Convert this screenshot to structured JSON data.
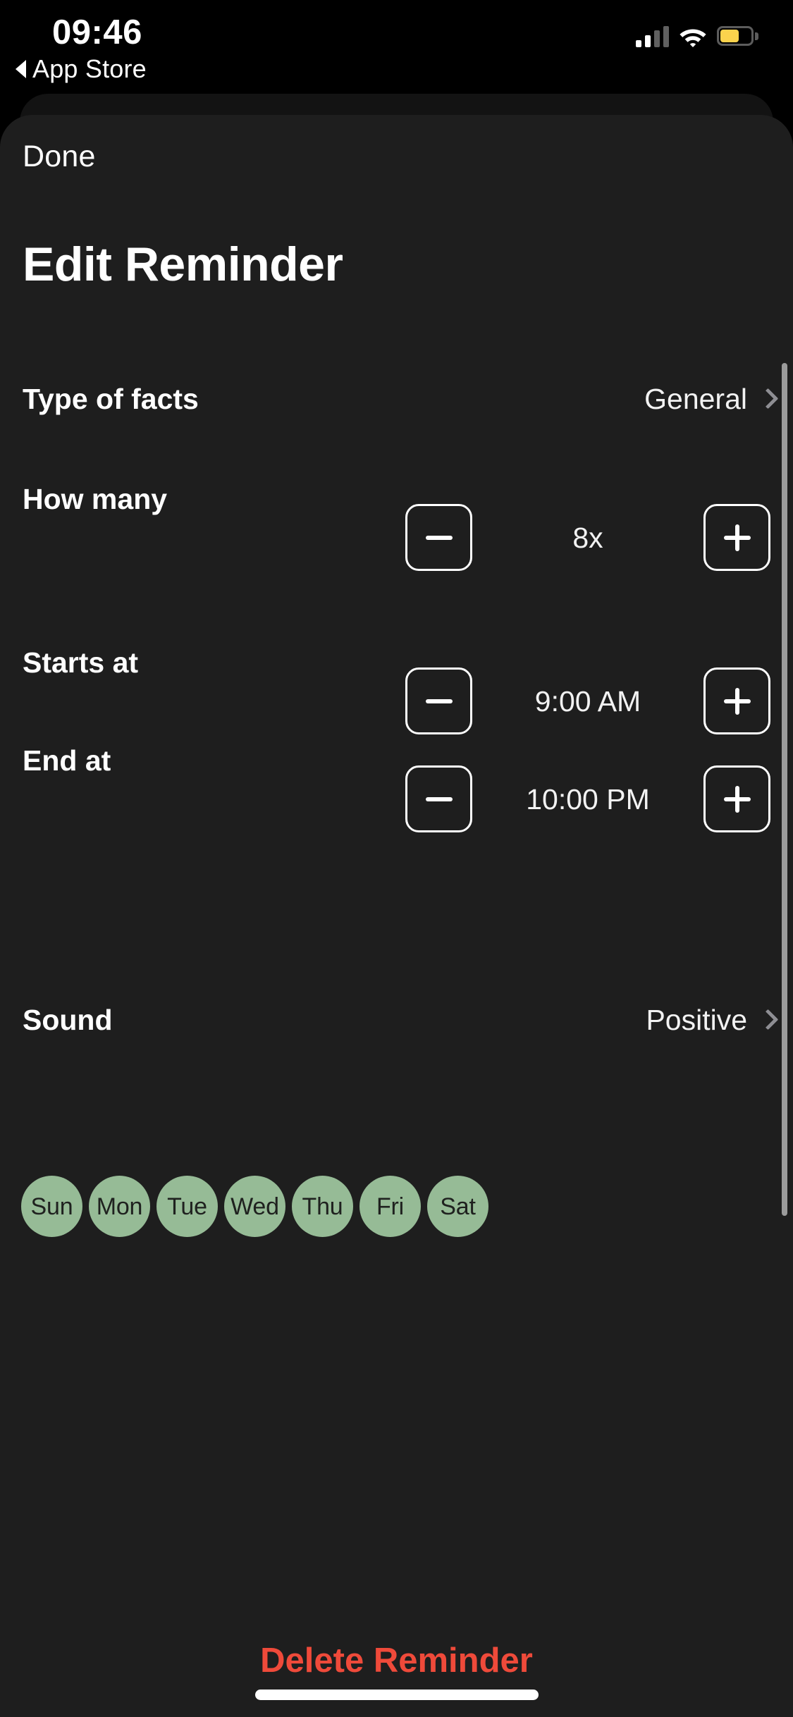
{
  "status_bar": {
    "time": "09:46",
    "back_label": "App Store",
    "back_icon": "back-triangle-icon",
    "signal_icon": "cellular-signal-icon",
    "signal_bars_active": 2,
    "signal_bars_total": 4,
    "wifi_icon": "wifi-icon",
    "battery_icon": "battery-icon",
    "battery_color": "#fbd34d",
    "battery_level_percent": 62
  },
  "sheet": {
    "done_label": "Done",
    "title": "Edit Reminder"
  },
  "rows": {
    "type_of_facts": {
      "label": "Type of facts",
      "value": "General",
      "chevron_icon": "chevron-right-icon"
    },
    "how_many": {
      "label": "How many",
      "value": "8x",
      "minus_icon": "minus-icon",
      "plus_icon": "plus-icon"
    },
    "starts_at": {
      "label": "Starts at",
      "value": "9:00 AM",
      "minus_icon": "minus-icon",
      "plus_icon": "plus-icon"
    },
    "end_at": {
      "label": "End at",
      "value": "10:00 PM",
      "minus_icon": "minus-icon",
      "plus_icon": "plus-icon"
    },
    "sound": {
      "label": "Sound",
      "value": "Positive",
      "chevron_icon": "chevron-right-icon"
    }
  },
  "days": [
    {
      "label": "Sun",
      "selected": true
    },
    {
      "label": "Mon",
      "selected": true
    },
    {
      "label": "Tue",
      "selected": true
    },
    {
      "label": "Wed",
      "selected": true
    },
    {
      "label": "Thu",
      "selected": true
    },
    {
      "label": "Fri",
      "selected": true
    },
    {
      "label": "Sat",
      "selected": true
    }
  ],
  "delete": {
    "label": "Delete Reminder",
    "color": "#ef4a3a"
  },
  "colors": {
    "background": "#000000",
    "sheet": "#1e1e1e",
    "sheet_backdrop": "#131313",
    "day_selected": "#96bb96",
    "day_text": "#1f211f",
    "destructive": "#ef4a3a",
    "secondary_text": "#8e8e93"
  }
}
